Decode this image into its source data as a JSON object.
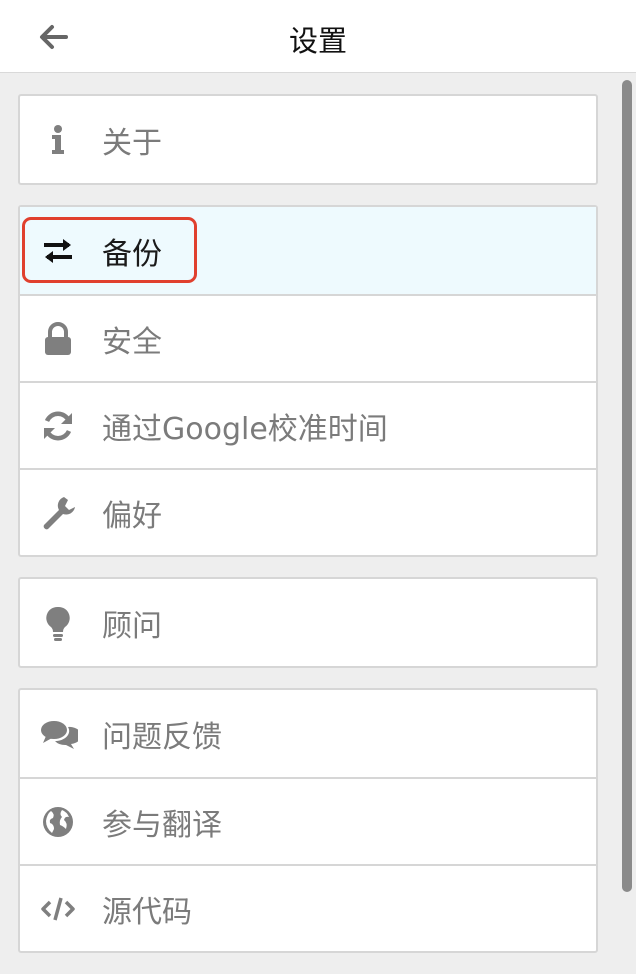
{
  "header": {
    "title": "设置",
    "back_icon": "arrow-left-icon"
  },
  "groups": [
    {
      "items": [
        {
          "label": "关于",
          "icon": "info-icon"
        }
      ]
    },
    {
      "items": [
        {
          "label": "备份",
          "icon": "swap-arrows-icon",
          "active": true
        },
        {
          "label": "安全",
          "icon": "lock-icon"
        },
        {
          "label": "通过Google校准时间",
          "icon": "sync-icon"
        },
        {
          "label": "偏好",
          "icon": "wrench-icon"
        }
      ]
    },
    {
      "items": [
        {
          "label": "顾问",
          "icon": "lightbulb-icon"
        }
      ]
    },
    {
      "items": [
        {
          "label": "问题反馈",
          "icon": "comments-icon"
        },
        {
          "label": "参与翻译",
          "icon": "globe-icon"
        },
        {
          "label": "源代码",
          "icon": "code-icon"
        }
      ]
    }
  ],
  "colors": {
    "highlight_border": "#e0402e",
    "active_row_bg": "#eefafe",
    "icon_gray": "#7f7f7f",
    "label_gray": "#7b7b7b"
  }
}
